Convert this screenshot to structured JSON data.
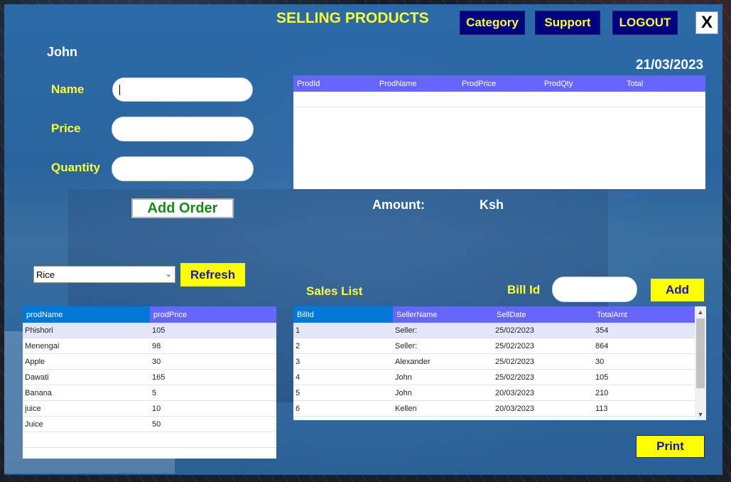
{
  "header": {
    "title": "SELLING PRODUCTS",
    "category_label": "Category",
    "support_label": "Support",
    "logout_label": "LOGOUT",
    "close_label": "X"
  },
  "user": {
    "name": "John"
  },
  "date": "21/03/2023",
  "form": {
    "name_label": "Name",
    "price_label": "Price",
    "quantity_label": "Quantity",
    "name_value": "",
    "price_value": "",
    "quantity_value": "",
    "add_order_label": "Add Order"
  },
  "order_grid": {
    "columns": [
      "ProdId",
      "ProdName",
      "ProdPrice",
      "ProdQty",
      "Total"
    ],
    "rows": []
  },
  "amount": {
    "label": "Amount:",
    "currency": "Ksh"
  },
  "category_filter": {
    "selected": "Rice",
    "refresh_label": "Refresh"
  },
  "products_grid": {
    "columns": [
      "prodName",
      "prodPrice"
    ],
    "rows": [
      [
        "Phishori",
        "105"
      ],
      [
        "Menengai",
        "98"
      ],
      [
        "Apple",
        "30"
      ],
      [
        "Dawati",
        "165"
      ],
      [
        "Banana",
        "5"
      ],
      [
        "juice",
        "10"
      ],
      [
        "Juice",
        "50"
      ]
    ]
  },
  "sales": {
    "title": "Sales List",
    "bill_id_label": "Bill Id",
    "bill_id_value": "",
    "add_label": "Add",
    "print_label": "Print",
    "columns": [
      "BillId",
      "SellerName",
      "SellDate",
      "TotalAmt"
    ],
    "rows": [
      [
        "1",
        "Seller:",
        "25/02/2023",
        "354"
      ],
      [
        "2",
        "Seller:",
        "25/02/2023",
        "864"
      ],
      [
        "3",
        "Alexander",
        "25/02/2023",
        "30"
      ],
      [
        "4",
        "John",
        "25/02/2023",
        "105"
      ],
      [
        "5",
        "John",
        "20/03/2023",
        "210"
      ],
      [
        "6",
        "Kellen",
        "20/03/2023",
        "113"
      ]
    ]
  },
  "colors": {
    "panel_blue": "#2b6aa8",
    "accent_yellow": "#ffff33",
    "nav_button_bg": "#000080",
    "grid_header": "#6666ff",
    "grid_header_first": "#0078d7"
  },
  "icons": [
    "chevron-down-icon",
    "scroll-up-icon",
    "scroll-down-icon"
  ]
}
